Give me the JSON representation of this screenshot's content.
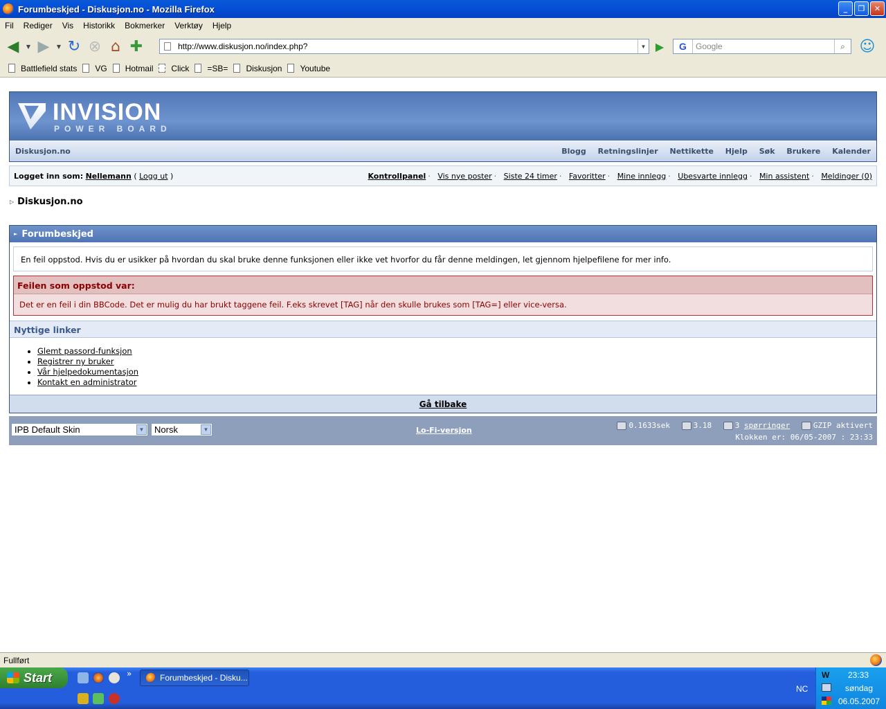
{
  "window": {
    "title": "Forumbeskjed - Diskusjon.no - Mozilla Firefox"
  },
  "menu": [
    "Fil",
    "Rediger",
    "Vis",
    "Historikk",
    "Bokmerker",
    "Verktøy",
    "Hjelp"
  ],
  "nav": {
    "url": "http://www.diskusjon.no/index.php?",
    "search_placeholder": "Google"
  },
  "bookmarks": [
    "Battlefield stats",
    "VG",
    "Hotmail",
    "Click",
    "=SB=",
    "Diskusjon",
    "Youtube"
  ],
  "header": {
    "brand": "INVISION",
    "brand_sub": "POWER BOARD",
    "site": "Diskusjon.no",
    "links": [
      "Blogg",
      "Retningslinjer",
      "Nettikette",
      "Hjelp",
      "Søk",
      "Brukere",
      "Kalender"
    ]
  },
  "userbar": {
    "logged_in_label": "Logget inn som:",
    "user": "Nellemann",
    "logout_open": "(",
    "logout": "Logg ut",
    "logout_close": ")",
    "control_panel": "Kontrollpanel",
    "links": [
      "Vis nye poster",
      "Siste 24 timer",
      "Favoritter",
      "Mine innlegg",
      "Ubesvarte innlegg",
      "Min assistent",
      "Meldinger (0)"
    ]
  },
  "breadcrumb": "Diskusjon.no",
  "message": {
    "title": "Forumbeskjed",
    "intro": "En feil oppstod. Hvis du er usikker på hvordan du skal bruke denne funksjonen eller ikke vet hvorfor du får denne meldingen, let gjennom hjelpefilene for mer info.",
    "error_title": "Feilen som oppstod var:",
    "error_text": "Det er en feil i din BBCode. Det er mulig du har brukt taggene feil. F.eks skrevet [TAG] når den skulle brukes som [TAG=] eller vice-versa.",
    "useful_title": "Nyttige linker",
    "useful_links": [
      "Glemt passord-funksjon",
      "Registrer ny bruker",
      "Vår hjelpedokumentasjon",
      "Kontakt en administrator"
    ],
    "go_back": "Gå tilbake"
  },
  "footer": {
    "skin": "IPB Default Skin",
    "language": "Norsk",
    "lofi": "Lo-Fi-versjon",
    "time": "0.1633sek",
    "load": "3.18",
    "queries_count": "3",
    "queries": "spørringer",
    "gzip": "GZIP aktivert",
    "clock": "Klokken er: 06/05-2007 : 23:33"
  },
  "statusbar": {
    "text": "Fullført"
  },
  "taskbar": {
    "start": "Start",
    "task": "Forumbeskjed - Disku...",
    "lang": "NC",
    "time": "23:33",
    "day": "søndag",
    "date": "06.05.2007"
  },
  "colors": {
    "accent": "#345487",
    "error": "#8b0000",
    "xp_blue": "#245edc"
  }
}
